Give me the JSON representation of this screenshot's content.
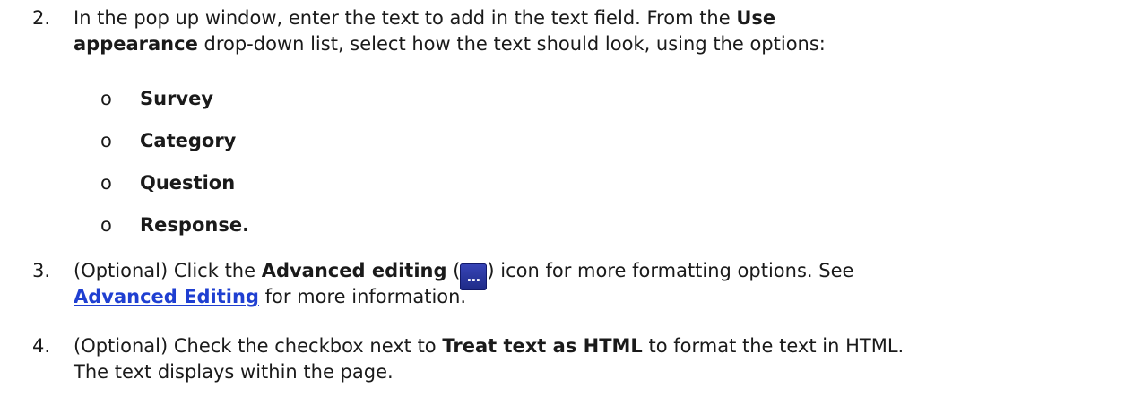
{
  "steps": [
    {
      "num": "2.",
      "line1_a": "In the pop up window, enter the text to add in the text field. From the ",
      "line1_b": "Use",
      "line2_a": "appearance",
      "line2_b": " drop-down list, select how the text should look, using the options:",
      "options": [
        "Survey",
        "Category",
        "Question",
        "Response."
      ],
      "bullet": "o"
    },
    {
      "num": "3.",
      "line1_a": "(Optional) Click the ",
      "line1_b": "Advanced editing",
      "line1_c": " (",
      "icon_glyph": "…",
      "line1_d": ") icon for more formatting options. See",
      "link": "Advanced Editing",
      "line2_b": " for more information."
    },
    {
      "num": "4.",
      "line1_a": "(Optional) Check the checkbox next to ",
      "line1_b": "Treat text as HTML",
      "line1_c": " to format the text in HTML.",
      "line2_a": "The text displays within the page."
    }
  ],
  "icons": {
    "advanced_editing": "advanced-editing-icon"
  }
}
